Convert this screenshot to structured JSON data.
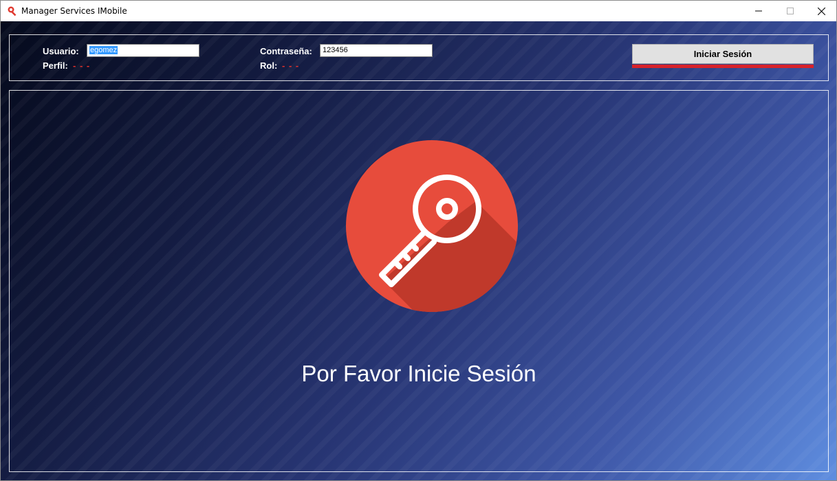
{
  "window": {
    "title": "Manager Services IMobile",
    "icon": "key-search-icon"
  },
  "login": {
    "usuario_label": "Usuario:",
    "usuario_value": "egomez",
    "contrasena_label": "Contraseña:",
    "contrasena_value": "123456",
    "perfil_label": "Perfil:",
    "perfil_value": "- - -",
    "rol_label": "Rol:",
    "rol_value": "- - -",
    "button_label": "Iniciar Sesión"
  },
  "main": {
    "icon": "key-icon",
    "message": "Por Favor Inicie Sesión"
  },
  "colors": {
    "accent": "#d8222a",
    "key_circle": "#e74c3c",
    "key_shadow": "#c0392b"
  }
}
